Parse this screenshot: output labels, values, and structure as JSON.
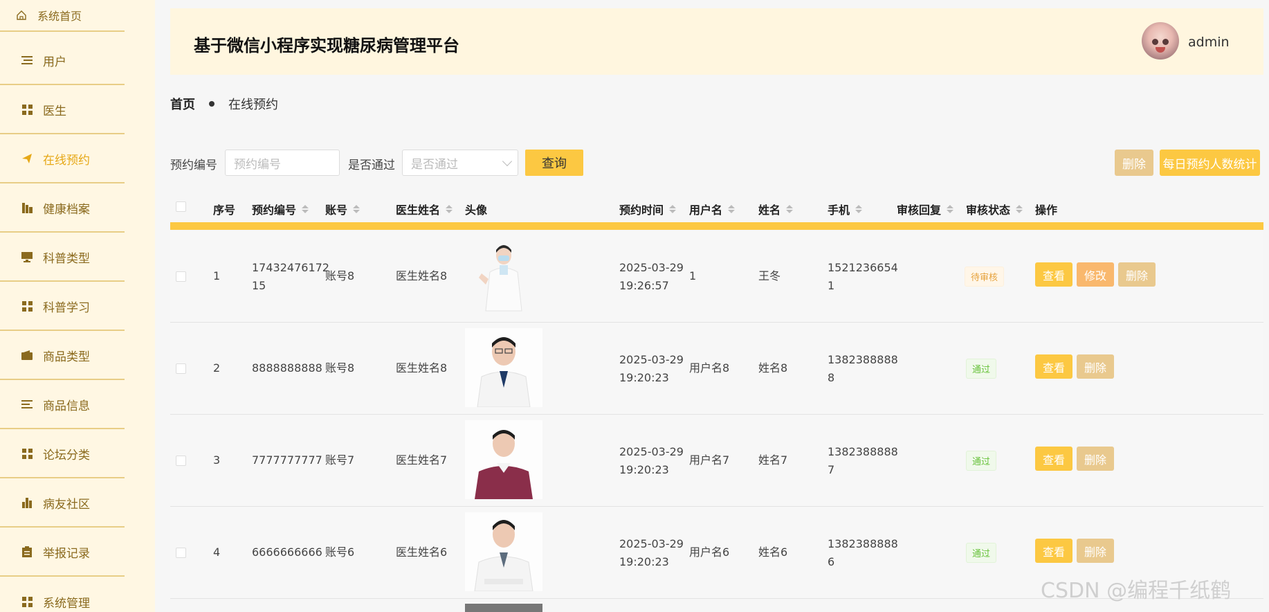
{
  "sidebar": {
    "home": "系统首页",
    "items": [
      {
        "label": "用户",
        "icon": "list-icon"
      },
      {
        "label": "医生",
        "icon": "grid-icon"
      },
      {
        "label": "在线预约",
        "icon": "send-icon"
      },
      {
        "label": "健康档案",
        "icon": "chart-icon"
      },
      {
        "label": "科普类型",
        "icon": "monitor-icon"
      },
      {
        "label": "科普学习",
        "icon": "grid-icon"
      },
      {
        "label": "商品类型",
        "icon": "wallet-icon"
      },
      {
        "label": "商品信息",
        "icon": "list-icon"
      },
      {
        "label": "论坛分类",
        "icon": "grid-icon"
      },
      {
        "label": "病友社区",
        "icon": "bar-chart-icon"
      },
      {
        "label": "举报记录",
        "icon": "clipboard-icon"
      },
      {
        "label": "系统管理",
        "icon": "grid-icon"
      }
    ]
  },
  "header": {
    "title": "基于微信小程序实现糖尿病管理平台",
    "user": "admin"
  },
  "breadcrumb": {
    "home": "首页",
    "current": "在线预约"
  },
  "search": {
    "label1": "预约编号",
    "placeholder1": "预约编号",
    "label2": "是否通过",
    "placeholder2": "是否通过",
    "query": "查询",
    "delete": "删除",
    "stats": "每日预约人数统计"
  },
  "table": {
    "headers": {
      "idx": "序号",
      "code": "预约编号",
      "account": "账号",
      "doctor": "医生姓名",
      "photo": "头像",
      "time": "预约时间",
      "user": "用户名",
      "name": "姓名",
      "phone": "手机",
      "reply": "审核回复",
      "status": "审核状态",
      "ops": "操作"
    },
    "rows": [
      {
        "idx": "1",
        "code1": "17432476172",
        "code2": "15",
        "account": "账号8",
        "doctor": "医生姓名8",
        "date": "2025-03-29",
        "time": "19:26:57",
        "user": "1",
        "name": "王冬",
        "phone1": "1521236654",
        "phone2": "1",
        "status": "待审核",
        "ops": [
          "查看",
          "修改",
          "删除"
        ]
      },
      {
        "idx": "2",
        "code1": "8888888888",
        "code2": "",
        "account": "账号8",
        "doctor": "医生姓名8",
        "date": "2025-03-29",
        "time": "19:20:23",
        "user": "用户名8",
        "name": "姓名8",
        "phone1": "1382388888",
        "phone2": "8",
        "status": "通过",
        "ops": [
          "查看",
          "删除"
        ]
      },
      {
        "idx": "3",
        "code1": "7777777777",
        "code2": "",
        "account": "账号7",
        "doctor": "医生姓名7",
        "date": "2025-03-29",
        "time": "19:20:23",
        "user": "用户名7",
        "name": "姓名7",
        "phone1": "1382388888",
        "phone2": "7",
        "status": "通过",
        "ops": [
          "查看",
          "删除"
        ]
      },
      {
        "idx": "4",
        "code1": "6666666666",
        "code2": "",
        "account": "账号6",
        "doctor": "医生姓名6",
        "date": "2025-03-29",
        "time": "19:20:23",
        "user": "用户名6",
        "name": "姓名6",
        "phone1": "1382388888",
        "phone2": "6",
        "status": "通过",
        "ops": [
          "查看",
          "删除"
        ]
      }
    ]
  },
  "watermark": "CSDN @编程千纸鹤",
  "colors": {
    "accent": "#fcc842",
    "sidebar_bg": "#fff7e3",
    "nav_text": "#8a6a1e",
    "active": "#e6a817"
  }
}
